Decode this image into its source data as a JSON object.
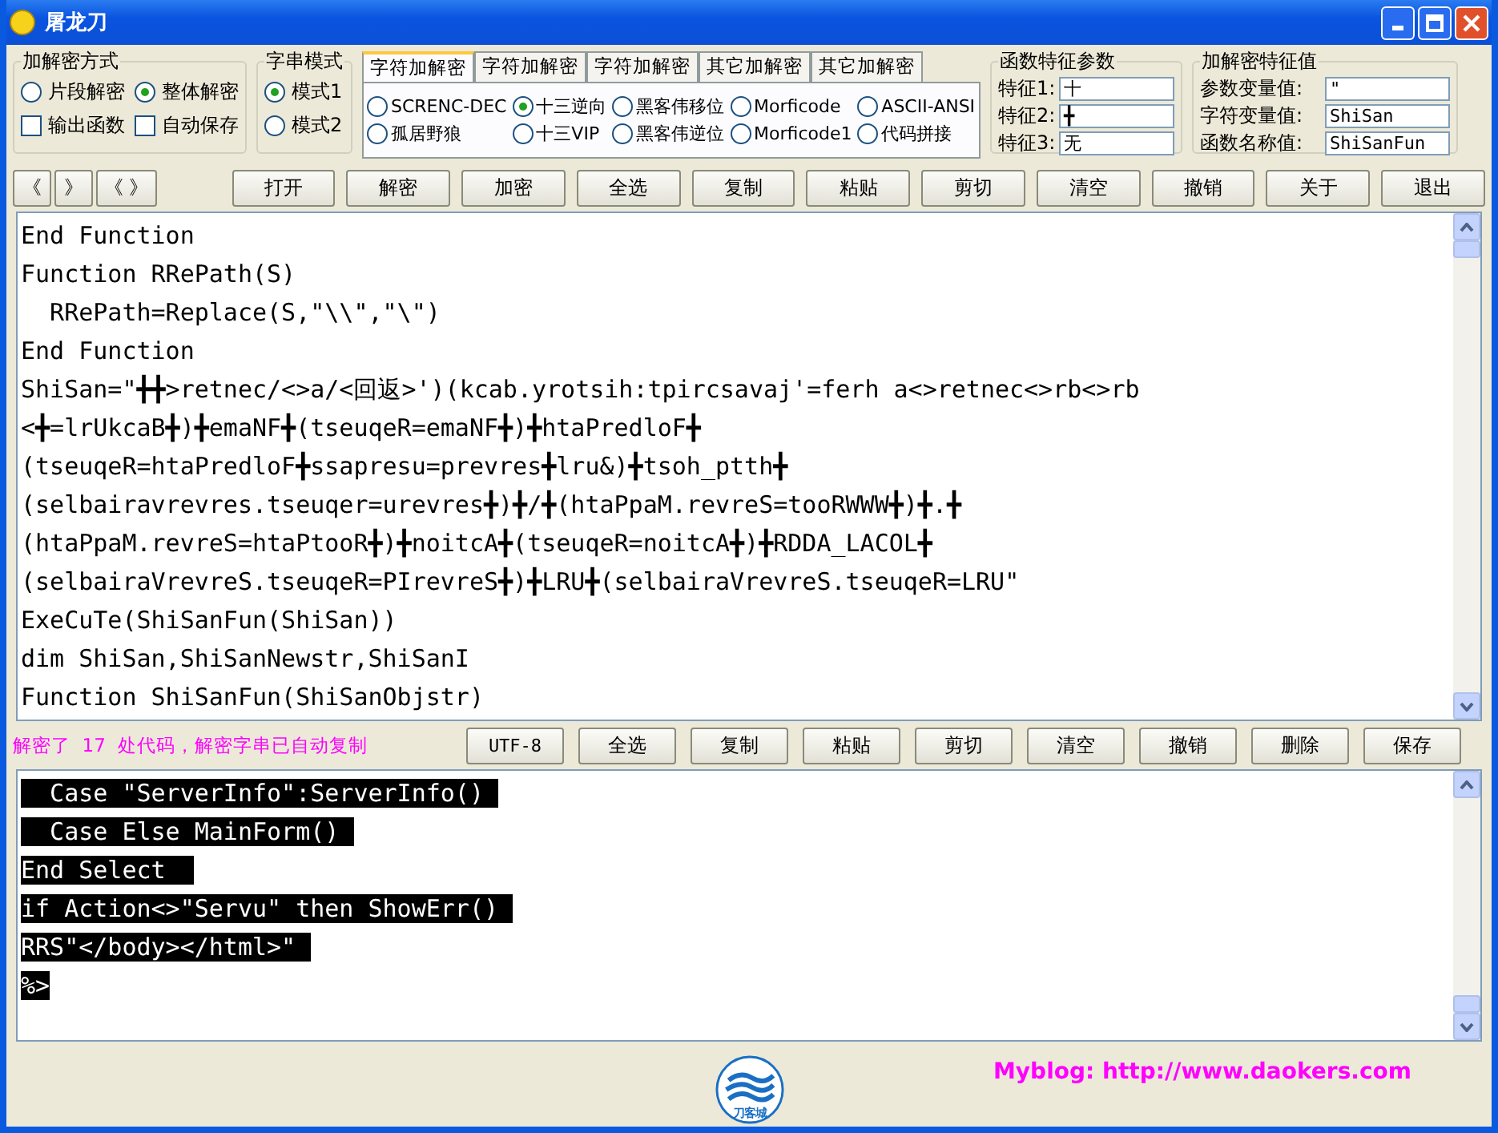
{
  "window": {
    "title": "屠龙刀"
  },
  "mode_group": {
    "title": "加解密方式",
    "options": [
      {
        "label": "片段解密",
        "selected": false
      },
      {
        "label": "整体解密",
        "selected": true
      }
    ],
    "checkboxes": [
      {
        "label": "输出函数",
        "checked": false
      },
      {
        "label": "自动保存",
        "checked": false
      }
    ]
  },
  "string_mode": {
    "title": "字串模式",
    "options": [
      {
        "label": "模式1",
        "selected": true
      },
      {
        "label": "模式2",
        "selected": false
      }
    ]
  },
  "tabs": [
    {
      "label": "字符加解密",
      "selected": true
    },
    {
      "label": "字符加解密",
      "selected": false
    },
    {
      "label": "字符加解密",
      "selected": false
    },
    {
      "label": "其它加解密",
      "selected": false
    },
    {
      "label": "其它加解密",
      "selected": false
    }
  ],
  "tab_options": [
    {
      "label": "SCRENC-DEC",
      "selected": false
    },
    {
      "label": "十三逆向",
      "selected": true
    },
    {
      "label": "黑客伟移位",
      "selected": false
    },
    {
      "label": "Morficode",
      "selected": false
    },
    {
      "label": "ASCII-ANSI",
      "selected": false
    },
    {
      "label": "孤居野狼",
      "selected": false
    },
    {
      "label": "十三VIP",
      "selected": false
    },
    {
      "label": "黑客伟逆位",
      "selected": false
    },
    {
      "label": "Morficode1",
      "selected": false
    },
    {
      "label": "代码拼接",
      "selected": false
    }
  ],
  "feature_params": {
    "title": "函数特征参数",
    "fields": [
      {
        "label": "特征1:",
        "value": "十"
      },
      {
        "label": "特征2:",
        "value": "╋"
      },
      {
        "label": "特征3:",
        "value": "无"
      }
    ]
  },
  "feature_values": {
    "title": "加解密特征值",
    "fields": [
      {
        "label": "参数变量值:",
        "value": "\""
      },
      {
        "label": "字符变量值:",
        "value": "ShiSan"
      },
      {
        "label": "函数名称值:",
        "value": "ShiSanFun"
      }
    ]
  },
  "nav_buttons": [
    "《",
    "》",
    "《 》"
  ],
  "toolbar": [
    "打开",
    "解密",
    "加密",
    "全选",
    "复制",
    "粘贴",
    "剪切",
    "清空",
    "撤销",
    "关于",
    "退出"
  ],
  "editor": {
    "lines": [
      "End Function",
      "Function RRePath(S)",
      "  RRePath=Replace(S,\"\\\\\",\"\\\")",
      "End Function",
      "ShiSan=\"╋╋>retnec/<>a/<回返>')(kcab.yrotsih:tpircsavaj'=ferh a<>retnec<>rb<>rb",
      "<╋=lrUkcaB╋)╋emaNF╋(tseuqeR=emaNF╋)╋htaPredloF╋",
      "(tseuqeR=htaPredloF╋ssapresu=prevres╋lru&)╋tsoh_ptth╋",
      "(selbairavrevres.tseuqer=urevres╋)╋/╋(htaPpaM.revreS=tooRWWW╋)╋.╋",
      "(htaPpaM.revreS=htaPtooR╋)╋noitcA╋(tseuqeR=noitcA╋)╋RDDA_LACOL╋",
      "(selbairaVrevreS.tseuqeR=PIrevreS╋)╋LRU╋(selbairaVrevreS.tseuqeR=LRU\"",
      "ExeCuTe(ShiSanFun(ShiSan))",
      "dim ShiSan,ShiSanNewstr,ShiSanI",
      "Function ShiSanFun(ShiSanObjstr)"
    ]
  },
  "status": "解密了  17  处代码，解密字串已自动复制",
  "toolbar2": [
    "UTF-8",
    "全选",
    "复制",
    "粘贴",
    "剪切",
    "清空",
    "撤销",
    "删除",
    "保存"
  ],
  "output": {
    "lines": [
      {
        "text": "  Case \"ServerInfo\":ServerInfo() ",
        "selected": true
      },
      {
        "text": "  Case Else MainForm() ",
        "selected": true
      },
      {
        "text": "End Select  ",
        "selected": true
      },
      {
        "text": "if Action<>\"Servu\" then ShowErr() ",
        "selected": true
      },
      {
        "text": "RRS\"</body></html>\" ",
        "selected": true
      },
      {
        "text": "%>",
        "selected": true
      }
    ]
  },
  "logo": {
    "text": "刀客城"
  },
  "blog_link": "Myblog: http://www.daokers.com"
}
